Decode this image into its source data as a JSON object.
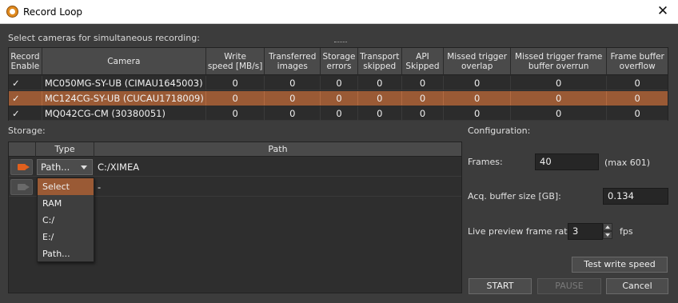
{
  "window": {
    "title": "Record Loop",
    "icon": "ximea-app-icon"
  },
  "cameras": {
    "label": "Select cameras for simultaneous recording:",
    "headers": [
      "Record\nEnable",
      "Camera",
      "Write\nspeed [MB/s]",
      "Transferred\nimages",
      "Storage\nerrors",
      "Transport\nskipped",
      "API\nSkipped",
      "Missed trigger\noverlap",
      "Missed trigger frame\nbuffer overrun",
      "Frame buffer\noverflow"
    ],
    "rows": [
      {
        "enable": "✓",
        "camera": "MC050MG-SY-UB (CIMAU1645003)",
        "write_speed": "0",
        "transferred": "0",
        "storage_errors": "0",
        "transport_skipped": "0",
        "api_skipped": "0",
        "missed_overlap": "0",
        "missed_overrun": "0",
        "buffer_overflow": "0",
        "selected": false
      },
      {
        "enable": "✓",
        "camera": "MC124CG-SY-UB (CUCAU1718009)",
        "write_speed": "0",
        "transferred": "0",
        "storage_errors": "0",
        "transport_skipped": "0",
        "api_skipped": "0",
        "missed_overlap": "0",
        "missed_overrun": "0",
        "buffer_overflow": "0",
        "selected": true
      },
      {
        "enable": "✓",
        "camera": "MQ042CG-CM (30380051)",
        "write_speed": "0",
        "transferred": "0",
        "storage_errors": "0",
        "transport_skipped": "0",
        "api_skipped": "0",
        "missed_overlap": "0",
        "missed_overrun": "0",
        "buffer_overflow": "0",
        "selected": false
      }
    ]
  },
  "storage": {
    "label": "Storage:",
    "headers": {
      "type": "Type",
      "path": "Path"
    },
    "rows": [
      {
        "type": "Path...",
        "path": "C:/XIMEA"
      },
      {
        "type": "",
        "path": "-"
      }
    ],
    "dropdown_options": [
      "Select",
      "RAM",
      "C:/",
      "E:/",
      "Path..."
    ],
    "dropdown_highlighted": "Select"
  },
  "configuration": {
    "label": "Configuration:",
    "frames_label": "Frames:",
    "frames_value": "40",
    "frames_max": "(max 601)",
    "buffer_label": "Acq. buffer size [GB]:",
    "buffer_value": "0.134",
    "preview_label": "Live preview frame rate:",
    "preview_value": "3",
    "preview_unit": "fps"
  },
  "buttons": {
    "test_write_speed": "Test  write speed",
    "start": "START",
    "pause": "PAUSE",
    "cancel": "Cancel"
  },
  "colors": {
    "selection": "#9a5a35",
    "accent_orange": "#e0601e",
    "background": "#3c3c3c"
  }
}
